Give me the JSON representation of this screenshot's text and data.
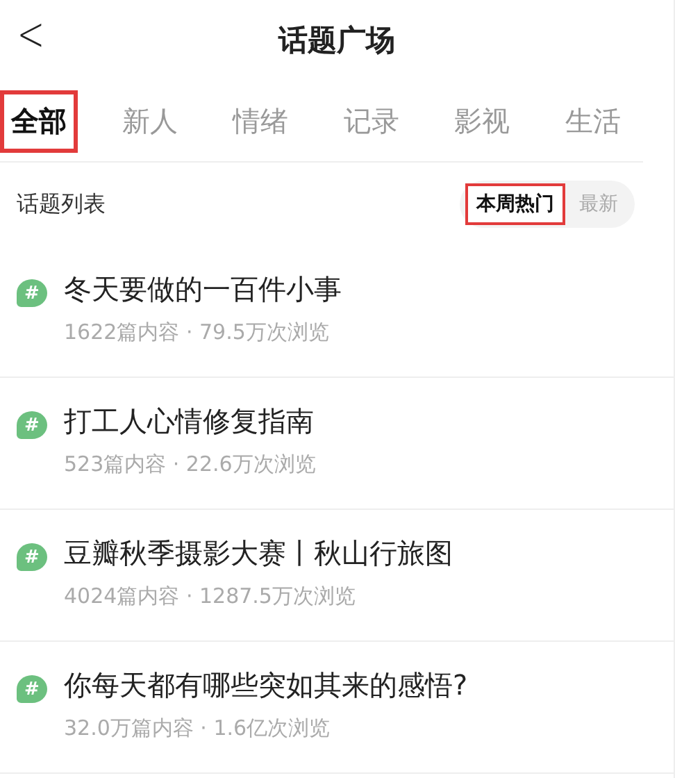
{
  "header": {
    "back": "<",
    "title": "话题广场"
  },
  "tabs": [
    {
      "label": "全部",
      "selected": true,
      "highlighted": true
    },
    {
      "label": "新人",
      "selected": false,
      "highlighted": false
    },
    {
      "label": "情绪",
      "selected": false,
      "highlighted": false
    },
    {
      "label": "记录",
      "selected": false,
      "highlighted": false
    },
    {
      "label": "影视",
      "selected": false,
      "highlighted": false
    },
    {
      "label": "生活",
      "selected": false,
      "highlighted": false
    }
  ],
  "section": {
    "title": "话题列表",
    "sorts": [
      {
        "label": "本周热门",
        "selected": true,
        "highlighted": true
      },
      {
        "label": "最新",
        "selected": false,
        "highlighted": false
      }
    ]
  },
  "topics": [
    {
      "icon": "#",
      "title": "冬天要做的一百件小事",
      "meta": "1622篇内容 · 79.5万次浏览"
    },
    {
      "icon": "#",
      "title": "打工人心情修复指南",
      "meta": "523篇内容 · 22.6万次浏览"
    },
    {
      "icon": "#",
      "title": "豆瓣秋季摄影大赛丨秋山行旅图",
      "meta": "4024篇内容 · 1287.5万次浏览"
    },
    {
      "icon": "#",
      "title": "你每天都有哪些突如其来的感悟?",
      "meta": "32.0万篇内容 · 1.6亿次浏览"
    }
  ]
}
